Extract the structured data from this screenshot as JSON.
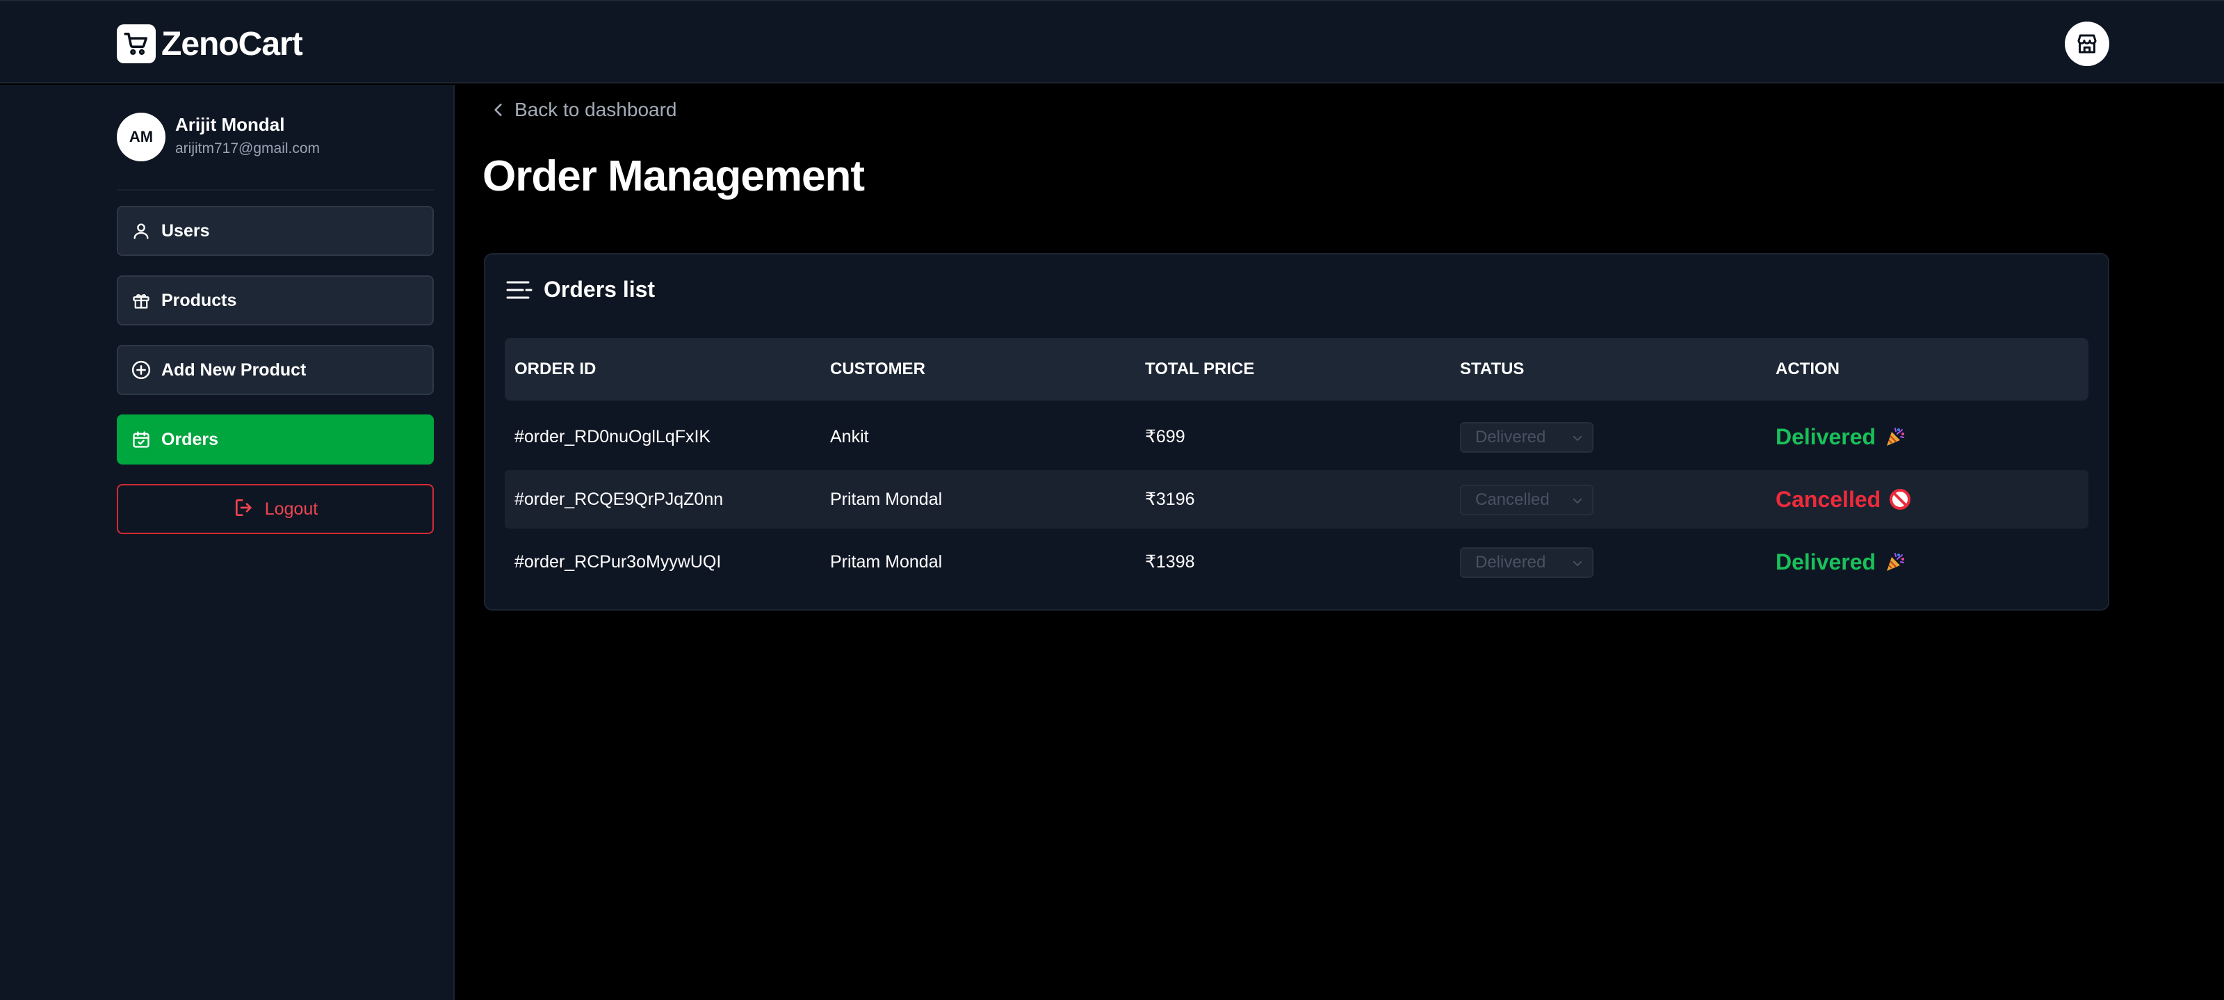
{
  "app": {
    "brand": "ZenoCart"
  },
  "profile": {
    "initials": "AM",
    "name": "Arijit Mondal",
    "email": "arijitm717@gmail.com"
  },
  "sidebar": {
    "items": [
      {
        "label": "Users",
        "icon": "user-icon"
      },
      {
        "label": "Products",
        "icon": "gift-icon"
      },
      {
        "label": "Add New Product",
        "icon": "plus-circle-icon"
      },
      {
        "label": "Orders",
        "icon": "calendar-check-icon",
        "active": true
      }
    ],
    "logout_label": "Logout"
  },
  "main": {
    "back_label": "Back to dashboard",
    "title": "Order Management",
    "card_title": "Orders list",
    "columns": [
      "ORDER ID",
      "CUSTOMER",
      "TOTAL PRICE",
      "STATUS",
      "ACTION"
    ],
    "rows": [
      {
        "order_id": "#order_RD0nuOglLqFxIK",
        "customer": "Ankit",
        "total": "₹699",
        "status": "Delivered",
        "action": "Delivered",
        "action_icon": "party-popper-icon"
      },
      {
        "order_id": "#order_RCQE9QrPJqZ0nn",
        "customer": "Pritam Mondal",
        "total": "₹3196",
        "status": "Cancelled",
        "action": "Cancelled",
        "action_icon": "prohibited-icon"
      },
      {
        "order_id": "#order_RCPur3oMyywUQI",
        "customer": "Pritam Mondal",
        "total": "₹1398",
        "status": "Delivered",
        "action": "Delivered",
        "action_icon": "party-popper-icon"
      }
    ]
  },
  "colors": {
    "active_green": "#00a63e",
    "delivered": "#19c15a",
    "cancelled": "#ee2b3b",
    "logout": "#d42a35"
  }
}
